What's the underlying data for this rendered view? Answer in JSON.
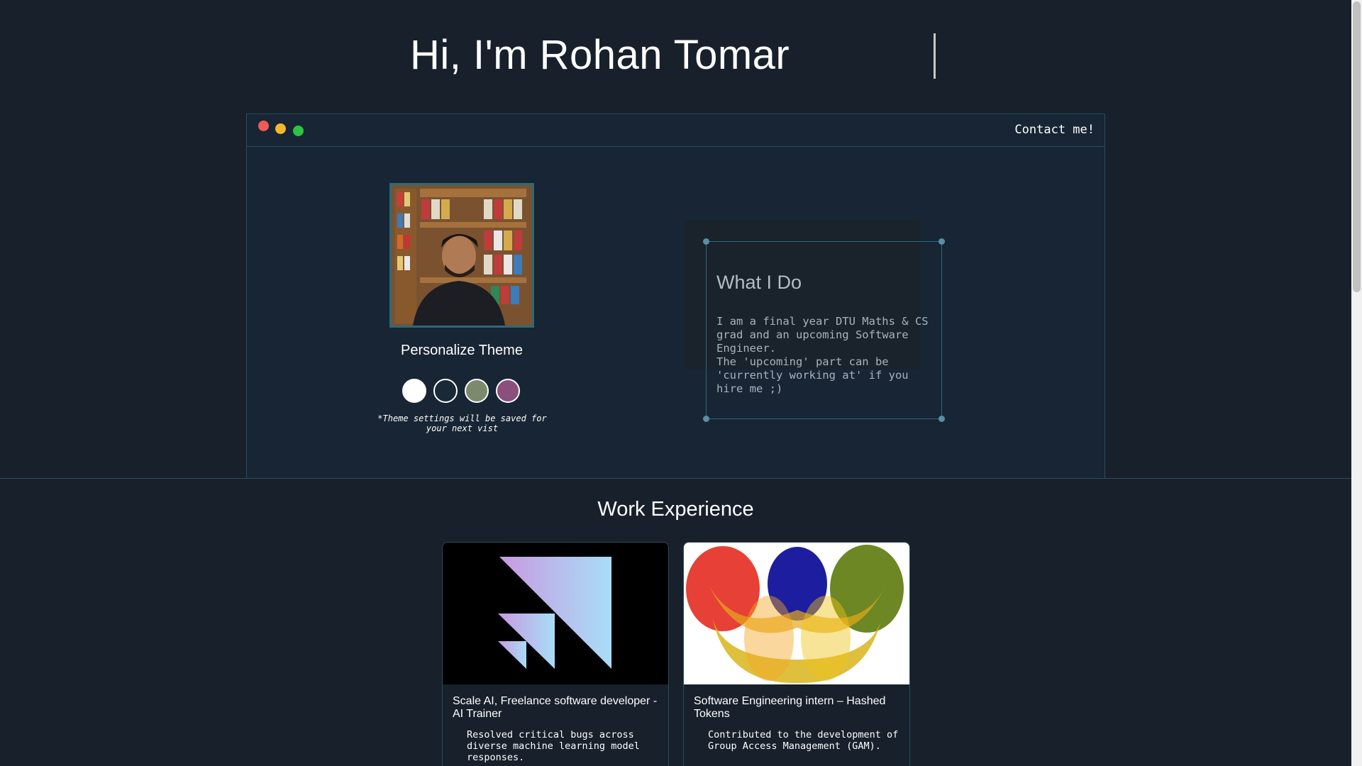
{
  "hero": {
    "title": "Hi, I'm Rohan Tomar"
  },
  "window": {
    "contact_label": "Contact me!"
  },
  "profile": {
    "avatar_alt": "Profile photo",
    "theme_title": "Personalize Theme",
    "theme_swatches": [
      {
        "name": "white",
        "color": "#ffffff"
      },
      {
        "name": "navy",
        "color": "#1b2838"
      },
      {
        "name": "olive",
        "color": "#7a8a6a"
      },
      {
        "name": "plum",
        "color": "#8a4f7d"
      }
    ],
    "theme_note": "*Theme settings will be saved for your next vist"
  },
  "what_i_do": {
    "title": "What I Do",
    "line1": "I am a final year DTU Maths & CS grad and an upcoming Software Engineer.",
    "line2": "The 'upcoming' part can be 'currently working at' if you hire me ;)"
  },
  "work": {
    "section_title": "Work Experience",
    "jobs": [
      {
        "title": "Scale AI, Freelance software developer -AI Trainer",
        "description": "Resolved critical bugs across diverse machine learning model responses.",
        "logo": "scale-ai-logo"
      },
      {
        "title": "Software Engineering intern – Hashed Tokens",
        "description": "Contributed to the development of Group Access Management (GAM).",
        "logo": "hashed-tokens-logo"
      }
    ]
  },
  "colors": {
    "background": "#17202b",
    "border": "#2a4d5c",
    "dot_red": "#ee5a57",
    "dot_yellow": "#f5b72c",
    "dot_green": "#2ec442"
  }
}
